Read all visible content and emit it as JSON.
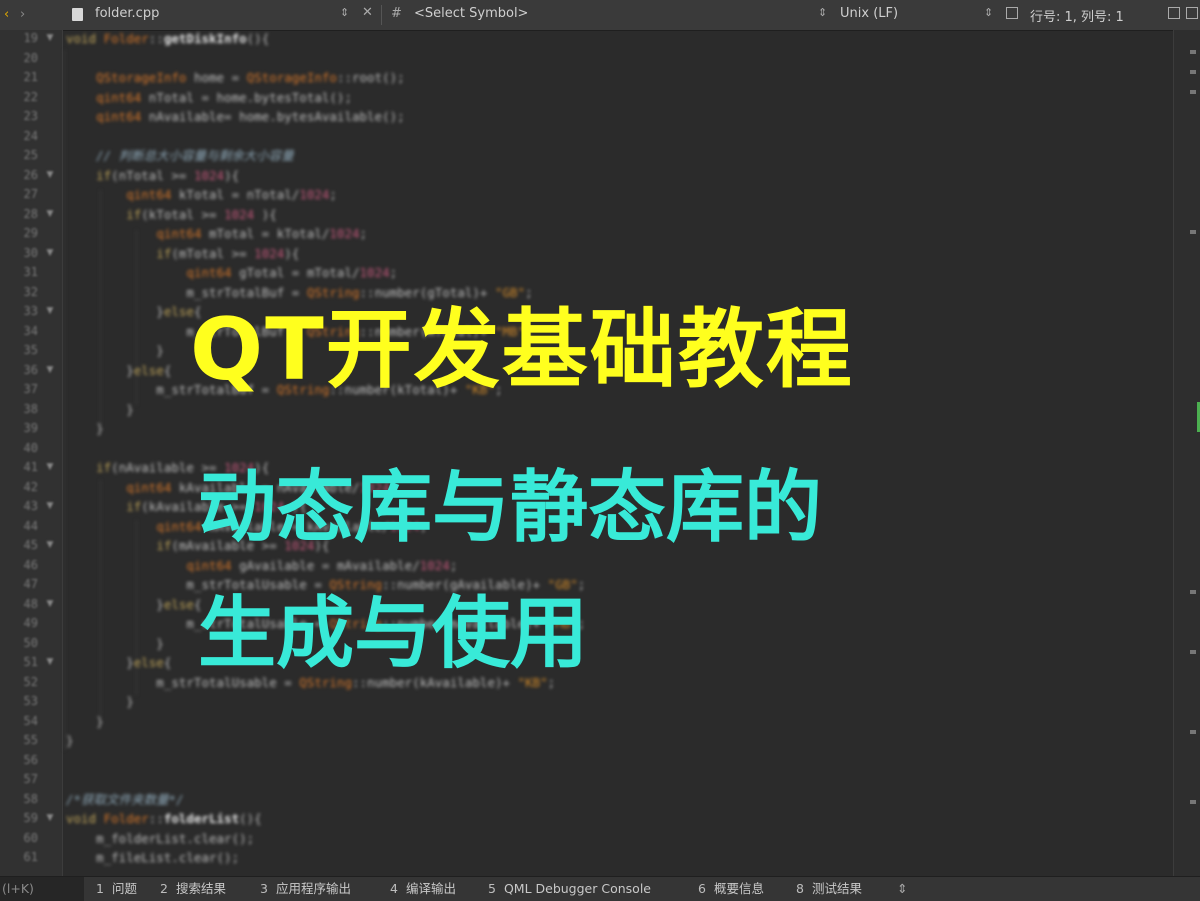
{
  "toolbar": {
    "back_icon": "‹",
    "forward_icon": "›",
    "file_name": "folder.cpp",
    "symbol_hash": "#",
    "symbol_placeholder": "<Select Symbol>",
    "encoding": "Unix (LF)",
    "cursor_position": "行号: 1, 列号: 1"
  },
  "editor": {
    "lines": [
      {
        "n": "19",
        "fold": "▼",
        "html": "<span class='kw'>void</span> <span class='ty'>Folder</span>::<span class='fn'>getDiskInfo</span>(){"
      },
      {
        "n": "20",
        "html": ""
      },
      {
        "n": "21",
        "html": "    <span class='ty'>QStorageInfo</span> home = <span class='ty'>QStorageInfo</span>::root();"
      },
      {
        "n": "22",
        "html": "    <span class='ty'>qint64</span> nTotal = home.bytesTotal();"
      },
      {
        "n": "23",
        "html": "    <span class='ty'>qint64</span> nAvailable= home.bytesAvailable();"
      },
      {
        "n": "24",
        "html": ""
      },
      {
        "n": "25",
        "html": "    <span class='cm'>// 判断总大小容量与剩余大小容量</span>"
      },
      {
        "n": "26",
        "fold": "▼",
        "html": "    <span class='kw'>if</span>(nTotal >= <span class='num'>1024</span>){"
      },
      {
        "n": "27",
        "html": "        <span class='ty'>qint64</span> kTotal = nTotal/<span class='num'>1024</span>;"
      },
      {
        "n": "28",
        "fold": "▼",
        "html": "        <span class='kw'>if</span>(kTotal >= <span class='num'>1024</span> ){"
      },
      {
        "n": "29",
        "html": "            <span class='ty'>qint64</span> mTotal = kTotal/<span class='num'>1024</span>;"
      },
      {
        "n": "30",
        "fold": "▼",
        "html": "            <span class='kw'>if</span>(mTotal >= <span class='num'>1024</span>){"
      },
      {
        "n": "31",
        "html": "                <span class='ty'>qint64</span> gTotal = mTotal/<span class='num'>1024</span>;"
      },
      {
        "n": "32",
        "html": "                m_strTotalBuf = <span class='ty'>QString</span>::number(gTotal)+ <span class='str'>\"GB\"</span>;"
      },
      {
        "n": "33",
        "fold": "▼",
        "html": "            }<span class='kw'>else</span>{"
      },
      {
        "n": "34",
        "html": "                m_strTotalBuf = <span class='ty'>QString</span>::number(mTotal)+ <span class='str'>\"MB\"</span>;"
      },
      {
        "n": "35",
        "html": "            }"
      },
      {
        "n": "36",
        "fold": "▼",
        "html": "        }<span class='kw'>else</span>{"
      },
      {
        "n": "37",
        "html": "            m_strTotalBuf = <span class='ty'>QString</span>::number(kTotal)+ <span class='str'>\"KB\"</span>;"
      },
      {
        "n": "38",
        "html": "        }"
      },
      {
        "n": "39",
        "html": "    }"
      },
      {
        "n": "40",
        "html": ""
      },
      {
        "n": "41",
        "fold": "▼",
        "html": "    <span class='kw'>if</span>(nAvailable >= <span class='num'>1024</span>){"
      },
      {
        "n": "42",
        "html": "        <span class='ty'>qint64</span> kAvailable = nAvailable/<span class='num'>1024</span>;"
      },
      {
        "n": "43",
        "fold": "▼",
        "html": "        <span class='kw'>if</span>(kAvailable >= <span class='num'>1024</span> ){"
      },
      {
        "n": "44",
        "html": "            <span class='ty'>qint64</span> mAvailable = kAvailable/<span class='num'>1024</span>;"
      },
      {
        "n": "45",
        "fold": "▼",
        "html": "            <span class='kw'>if</span>(mAvailable >= <span class='num'>1024</span>){"
      },
      {
        "n": "46",
        "html": "                <span class='ty'>qint64</span> gAvailable = mAvailable/<span class='num'>1024</span>;"
      },
      {
        "n": "47",
        "html": "                m_strTotalUsable = <span class='ty'>QString</span>::number(gAvailable)+ <span class='str'>\"GB\"</span>;"
      },
      {
        "n": "48",
        "fold": "▼",
        "html": "            }<span class='kw'>else</span>{"
      },
      {
        "n": "49",
        "html": "                m_strTotalUsable = <span class='ty'>QString</span>::number(mAvailable)+ <span class='str'>\"MB\"</span>;"
      },
      {
        "n": "50",
        "html": "            }"
      },
      {
        "n": "51",
        "fold": "▼",
        "html": "        }<span class='kw'>else</span>{"
      },
      {
        "n": "52",
        "html": "            m_strTotalUsable = <span class='ty'>QString</span>::number(kAvailable)+ <span class='str'>\"KB\"</span>;"
      },
      {
        "n": "53",
        "html": "        }"
      },
      {
        "n": "54",
        "html": "    }"
      },
      {
        "n": "55",
        "html": "}"
      },
      {
        "n": "56",
        "html": ""
      },
      {
        "n": "57",
        "html": ""
      },
      {
        "n": "58",
        "html": "<span class='cm'>/*获取文件夹数量*/</span>"
      },
      {
        "n": "59",
        "fold": "▼",
        "html": "<span class='kw'>void</span> <span class='ty'>Folder</span>::<span class='fn'>folderList</span>(){"
      },
      {
        "n": "60",
        "html": "    m_folderList.clear();"
      },
      {
        "n": "61",
        "html": "    m_fileList.clear();"
      }
    ]
  },
  "statusbar": {
    "locator_placeholder": "(l+K)",
    "tabs": [
      {
        "num": "1",
        "label": "问题"
      },
      {
        "num": "2",
        "label": "搜索结果"
      },
      {
        "num": "3",
        "label": "应用程序输出"
      },
      {
        "num": "4",
        "label": "编译输出"
      },
      {
        "num": "5",
        "label": "QML Debugger Console"
      },
      {
        "num": "6",
        "label": "概要信息"
      },
      {
        "num": "8",
        "label": "测试结果"
      }
    ],
    "more_icon": "⇕"
  },
  "overlay": {
    "title_line1": "QT开发基础教程",
    "title_line2": "动态库与静态库的",
    "title_line3": "生成与使用"
  },
  "colors": {
    "title_yellow": "#ffff1e",
    "title_cyan": "#38ead8",
    "editor_bg": "#2b2b2b"
  }
}
